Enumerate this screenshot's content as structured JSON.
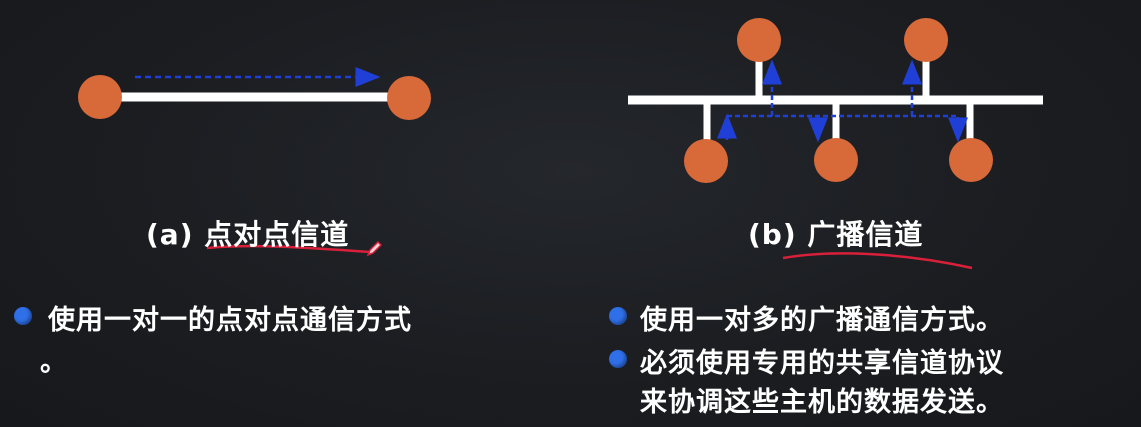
{
  "colors": {
    "background": "#1b1d21",
    "node": "#d86a3a",
    "line": "#ffffff",
    "arrow": "#1f3fd6",
    "bullet": "#2f6fe8",
    "underline": "#d8203a"
  },
  "left_panel": {
    "caption_label": "(a)",
    "caption_title": "点对点信道",
    "bullets": [
      {
        "text": "使用一对一的点对点通信方式"
      }
    ],
    "trailing_mark": "。"
  },
  "right_panel": {
    "caption_label": "(b)",
    "caption_title": "广播信道",
    "bullets": [
      {
        "text": "使用一对多的广播通信方式。"
      },
      {
        "text": "必须使用专用的共享信道协议",
        "continuation": "来协调这些主机的数据发送。"
      }
    ]
  },
  "icons": {
    "pen": "pen-icon"
  }
}
